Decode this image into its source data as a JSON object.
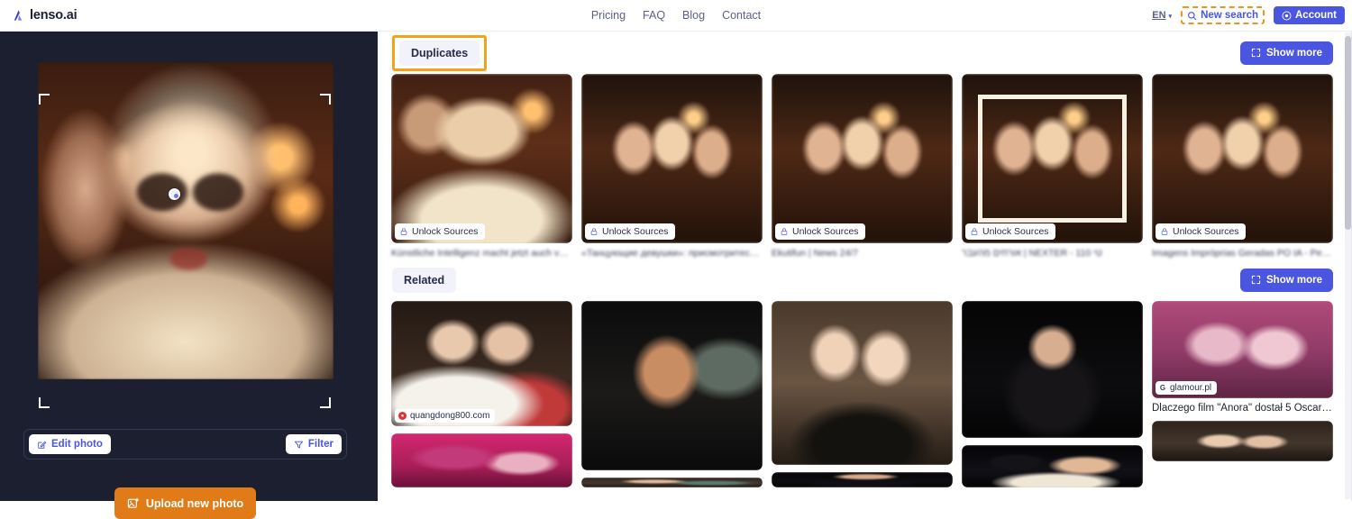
{
  "header": {
    "brand": "lenso.ai",
    "brand_logo_icon": "lenso-logo-icon",
    "nav": [
      {
        "label": "Pricing"
      },
      {
        "label": "FAQ"
      },
      {
        "label": "Blog"
      },
      {
        "label": "Contact"
      }
    ],
    "language": {
      "label": "EN",
      "chevron": "▾"
    },
    "new_search": {
      "label": "New search",
      "icon": "search-icon",
      "highlighted": true,
      "highlight_color": "#f0921f"
    },
    "account": {
      "label": "Account",
      "icon": "user-circle-icon"
    }
  },
  "sidebar": {
    "background_color": "#1b1f2f",
    "photo": {
      "alt": "uploaded-photo-crop",
      "crop_handles": 4,
      "face_marker": "face-selection-dot"
    },
    "edit_photo": {
      "label": "Edit photo",
      "icon": "pencil-square-icon"
    },
    "filter": {
      "label": "Filter",
      "icon": "funnel-icon"
    },
    "upload": {
      "label": "Upload new photo",
      "icon": "image-plus-icon",
      "color": "#e07b18"
    }
  },
  "main": {
    "sections": [
      {
        "id": "duplicates",
        "tab_label": "Duplicates",
        "tab_highlighted": true,
        "highlight_color": "#f5a11a",
        "show_more": {
          "label": "Show more",
          "icon": "expand-icon"
        },
        "cards": [
          {
            "unlock_label": "Unlock Sources",
            "unlock_icon": "lock-icon",
            "caption": "Künstliche Intelligenz macht jetzt auch ve…",
            "caption_blurred": true,
            "art": "ph1"
          },
          {
            "unlock_label": "Unlock Sources",
            "unlock_icon": "lock-icon",
            "caption": "«Танцующие девушки»: присмотритесь …",
            "caption_blurred": true,
            "art": "ph2"
          },
          {
            "unlock_label": "Unlock Sources",
            "unlock_icon": "lock-icon",
            "caption": "Ekutifun | News 24/7",
            "caption_blurred": true,
            "art": "ph2"
          },
          {
            "unlock_label": "Unlock Sources",
            "unlock_icon": "lock-icon",
            "caption": "אורחים מהעבר | NEXTER - 110 טי",
            "caption_blurred": true,
            "art": "ph2"
          },
          {
            "unlock_label": "Unlock Sources",
            "unlock_icon": "lock-icon",
            "caption": "Imagens Impróprias Geradas PO IA - Pes…",
            "caption_blurred": true,
            "art": "ph2"
          }
        ]
      },
      {
        "id": "related",
        "tab_label": "Related",
        "tab_highlighted": false,
        "show_more": {
          "label": "Show more",
          "icon": "expand-icon"
        },
        "cards": [
          {
            "source": "quangdong800.com",
            "favicon": "red-circle-favicon",
            "caption": "",
            "art": "rl1"
          },
          {
            "source": "",
            "favicon": "",
            "caption": "",
            "art": "rl2"
          },
          {
            "source": "",
            "favicon": "",
            "caption": "",
            "art": "rl3"
          },
          {
            "source": "",
            "favicon": "",
            "caption": "",
            "art": "rl4"
          },
          {
            "source": "glamour.pl",
            "favicon": "G",
            "caption": "Dlaczego film \"Anora\" dostał 5 Oscarów? …",
            "art": "rl5"
          }
        ],
        "cards_row2": [
          {
            "art": "rl6"
          },
          {
            "art": "rl7"
          },
          {
            "art": "rl8"
          },
          {
            "art": "rl9"
          },
          {
            "art": "rl10"
          }
        ]
      }
    ]
  },
  "scrollbar": {
    "name": "page-vertical-scrollbar"
  }
}
